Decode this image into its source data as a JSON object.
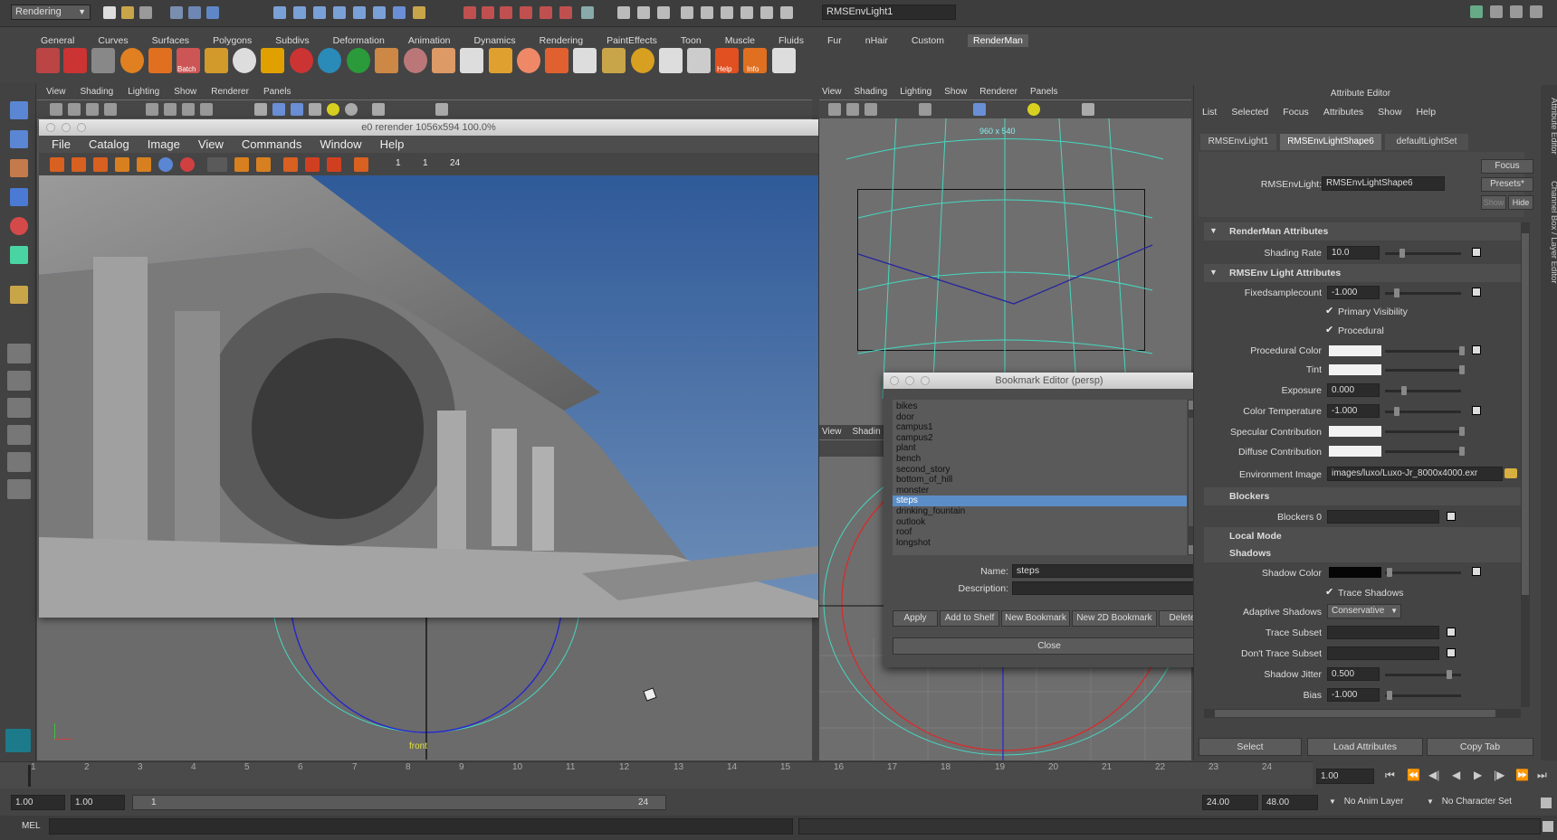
{
  "top_bar": {
    "mode": "Rendering",
    "object_name": "RMSEnvLight1"
  },
  "shelf_tabs": [
    "General",
    "Curves",
    "Surfaces",
    "Polygons",
    "Subdivs",
    "Deformation",
    "Animation",
    "Dynamics",
    "Rendering",
    "PaintEffects",
    "Toon",
    "Muscle",
    "Fluids",
    "Fur",
    "nHair",
    "Custom",
    "RenderMan"
  ],
  "shelf_icon_labels": {
    "batch": "Batch",
    "help": "Help",
    "info": "Info"
  },
  "panel_menu": [
    "View",
    "Shading",
    "Lighting",
    "Show",
    "Renderer",
    "Panels"
  ],
  "render_view": {
    "title": "e0 rerender 1056x594 100.0%",
    "menu": [
      "File",
      "Catalog",
      "Image",
      "View",
      "Commands",
      "Window",
      "Help"
    ],
    "frame_fields": [
      "1",
      "1",
      "24"
    ],
    "viewport_label": "front"
  },
  "right_panel": {
    "menu": [
      "View",
      "Shading",
      "Lighting",
      "Show",
      "Renderer",
      "Panels"
    ],
    "resolution": "960 x 540",
    "lower_menu": [
      "View",
      "Shadin"
    ]
  },
  "bookmark_editor": {
    "title": "Bookmark Editor (persp)",
    "items": [
      "bikes",
      "door",
      "campus1",
      "campus2",
      "plant",
      "bench",
      "second_story",
      "bottom_of_hill",
      "monster",
      "steps",
      "drinking_fountain",
      "outlook",
      "roof",
      "longshot"
    ],
    "selected": "steps",
    "name_label": "Name:",
    "name_value": "steps",
    "description_label": "Description:",
    "buttons": [
      "Apply",
      "Add to Shelf",
      "New Bookmark",
      "New 2D Bookmark",
      "Delete"
    ],
    "close": "Close"
  },
  "attribute_editor": {
    "title": "Attribute Editor",
    "menu": [
      "List",
      "Selected",
      "Focus",
      "Attributes",
      "Show",
      "Help"
    ],
    "tabs": [
      "RMSEnvLight1",
      "RMSEnvLightShape6",
      "defaultLightSet"
    ],
    "node_label": "RMSEnvLight:",
    "node_value": "RMSEnvLightShape6",
    "focus": "Focus",
    "presets": "Presets*",
    "show": "Show",
    "hide": "Hide",
    "sections": {
      "renderman": "RenderMan Attributes",
      "rmsenv": "RMSEnv  Light Attributes",
      "blockers": "Blockers",
      "local_mode": "Local Mode",
      "shadows": "Shadows"
    },
    "shading_rate": {
      "label": "Shading Rate",
      "value": "10.0"
    },
    "fixedsamplecount": {
      "label": "Fixedsamplecount",
      "value": "-1.000"
    },
    "primary_visibility": "Primary Visibility",
    "procedural": "Procedural",
    "procedural_color": "Procedural Color",
    "tint": "Tint",
    "exposure": {
      "label": "Exposure",
      "value": "0.000"
    },
    "color_temperature": {
      "label": "Color Temperature",
      "value": "-1.000"
    },
    "specular_contribution": "Specular Contribution",
    "diffuse_contribution": "Diffuse Contribution",
    "environment_image": {
      "label": "Environment Image",
      "value": "images/luxo/Luxo-Jr_8000x4000.exr"
    },
    "blockers_0": "Blockers 0",
    "shadow_color": "Shadow Color",
    "trace_shadows": "Trace Shadows",
    "adaptive_shadows": {
      "label": "Adaptive Shadows",
      "value": "Conservative"
    },
    "trace_subset": "Trace Subset",
    "dont_trace_subset": "Don't Trace Subset",
    "shadow_jitter": {
      "label": "Shadow Jitter",
      "value": "0.500"
    },
    "bias": {
      "label": "Bias",
      "value": "-1.000"
    },
    "bottom_buttons": [
      "Select",
      "Load Attributes",
      "Copy Tab"
    ],
    "side_tabs": [
      "Attribute Editor",
      "Channel Box / Layer Editor"
    ]
  },
  "timeline": {
    "ticks": [
      "1",
      "2",
      "3",
      "4",
      "5",
      "6",
      "7",
      "8",
      "9",
      "10",
      "11",
      "12",
      "13",
      "14",
      "15",
      "16",
      "17",
      "18",
      "19",
      "20",
      "21",
      "22",
      "23",
      "24"
    ],
    "current_frame": "1.00"
  },
  "range_bar": {
    "start": "1.00",
    "start2": "1.00",
    "range_start": "1",
    "range_end": "24",
    "end": "24.00",
    "end2": "48.00",
    "anim_layer": "No Anim Layer",
    "character_set": "No Character Set"
  },
  "command_line": {
    "label": "MEL"
  },
  "colors": {
    "accent_selected": "#5b8ec8",
    "background": "#444444",
    "sky": "#3f6499",
    "wireframe": "#46d8c0"
  }
}
